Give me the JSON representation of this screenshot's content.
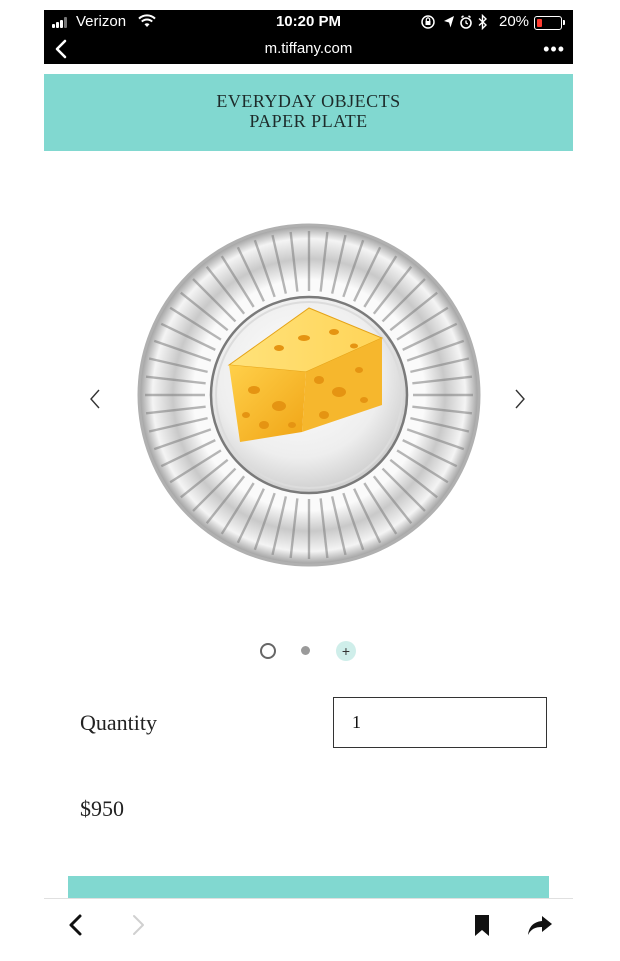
{
  "status_bar": {
    "carrier": "Verizon",
    "time": "10:20 PM",
    "battery_percent": "20%",
    "battery_color": "#ff3b30"
  },
  "browser": {
    "url": "m.tiffany.com",
    "more_label": "•••"
  },
  "header": {
    "line1": "EVERYDAY OBJECTS",
    "line2": "PAPER PLATE",
    "accent_color": "#81d8d0"
  },
  "gallery": {
    "prev_icon": "chevron-left-icon",
    "next_icon": "chevron-right-icon",
    "image_subject": "silver plate with cheese wedge",
    "indicators": [
      "empty-ring",
      "filled-dot",
      "plus"
    ],
    "plus_label": "+"
  },
  "purchase": {
    "quantity_label": "Quantity",
    "quantity_value": "1",
    "price": "$950"
  },
  "toolbar": {
    "icons": [
      "back-icon",
      "forward-icon",
      "bookmarks-icon",
      "share-icon"
    ]
  }
}
